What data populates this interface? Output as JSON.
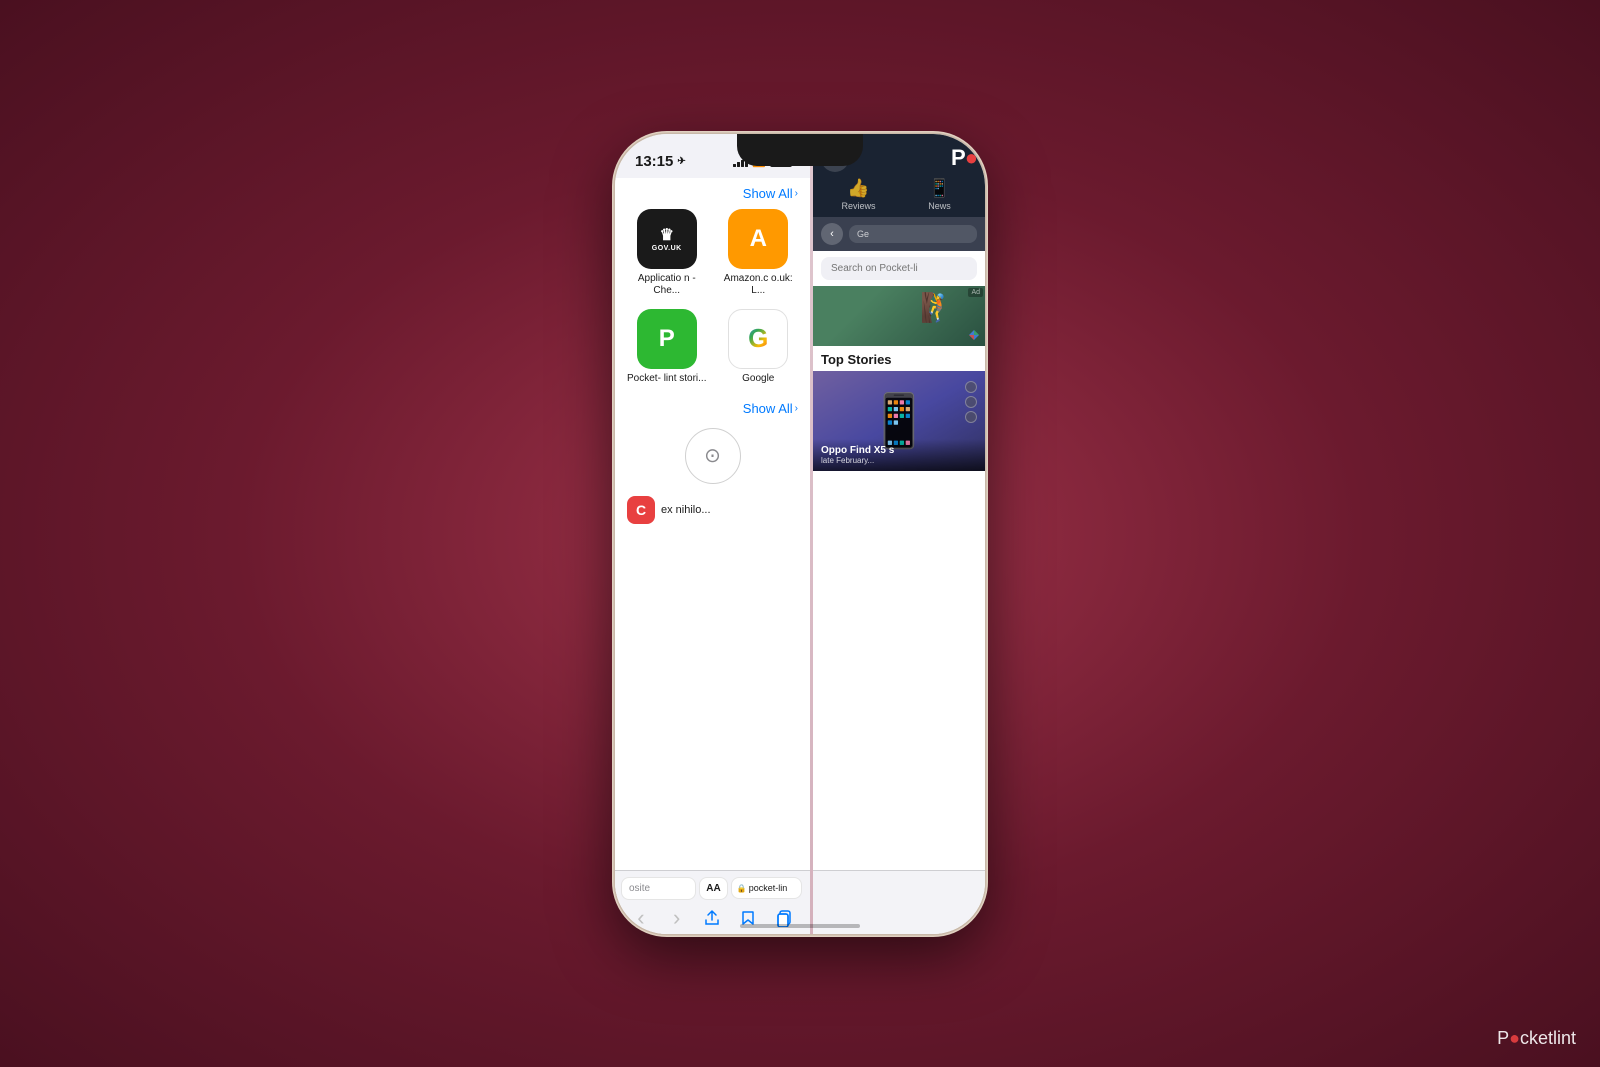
{
  "background": {
    "gradient": "radial dark red-purple"
  },
  "phone": {
    "status_bar": {
      "time": "13:15",
      "location_arrow": "▲",
      "wifi": true,
      "signal": true,
      "battery": "full"
    },
    "left_panel": {
      "show_all_label": "Show All",
      "apps": [
        {
          "id": "govuk",
          "name": "Applicatio\nn - Che...",
          "icon_text": "GOV.UK",
          "bg_color": "#1a1a1a"
        },
        {
          "id": "amazon",
          "name": "Amazon.c\no.uk: L...",
          "icon_letter": "A",
          "bg_color": "#ff9900"
        },
        {
          "id": "pocketlint",
          "name": "Pocket-\nlint stori...",
          "icon_letter": "P",
          "bg_color": "#2db832"
        },
        {
          "id": "google",
          "name": "Google",
          "icon_text": "G",
          "bg_color": "white"
        }
      ],
      "show_all_label2": "Show All",
      "compass_section": {
        "icon": "⊙"
      },
      "ex_nihilo": {
        "label": "ex nihilo...",
        "icon": "C"
      }
    },
    "bottom_toolbar": {
      "url_left_placeholder": "osite",
      "aa_label": "AA",
      "url_right_domain": "pocket-lin",
      "lock_icon": "🔒",
      "nav": {
        "back": "‹",
        "forward": "›",
        "share": "⬆",
        "bookmarks": "📖",
        "tabs": "⧉"
      }
    },
    "right_panel": {
      "header": {
        "logo": "P●",
        "logo_dot_color": "#e84040",
        "moon_icon": "🌙",
        "nav_items": [
          {
            "icon": "👍",
            "label": "Reviews"
          },
          {
            "icon": "📱",
            "label": "News"
          }
        ]
      },
      "toolbar": {
        "back_icon": "‹",
        "url_text": "Ge"
      },
      "search": {
        "placeholder": "Search on Pocket-li"
      },
      "ad": {
        "label": "Ad"
      },
      "content": {
        "top_stories_label": "Top Stories",
        "story": {
          "title": "Oppo Find X5 s",
          "subtitle": "late February..."
        }
      }
    }
  },
  "watermark": {
    "text_before": "P",
    "text_accent": "●",
    "text_after": "cketlint"
  }
}
